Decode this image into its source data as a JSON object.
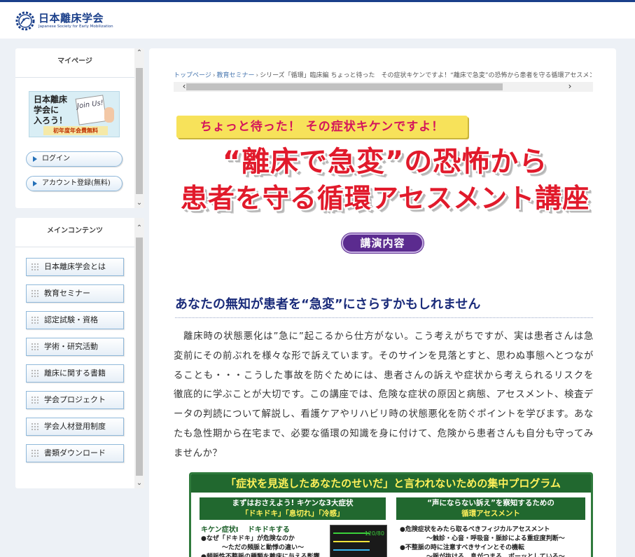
{
  "colors": {
    "brand": "#1a3f8a",
    "title_red": "#e11a2b",
    "accent_green": "#21682f",
    "accent_purple": "#5b2b8f"
  },
  "header": {
    "logo_jp": "日本離床学会",
    "logo_en": "Japanese Society for Early Mobilization",
    "logo_icon": "gear-logo-icon"
  },
  "sidebar": {
    "mypage": {
      "title": "マイページ",
      "banner": {
        "line1": "日本離床",
        "line2": "学会に",
        "line3": "入ろう！",
        "card": "Join Us!",
        "strip": "初年度年会費無料"
      },
      "login": "ログイン",
      "register": "アカウント登録(無料)"
    },
    "main_contents": {
      "title": "メインコンテンツ",
      "items": [
        {
          "label": "日本離床学会とは"
        },
        {
          "label": "教育セミナー"
        },
        {
          "label": "認定試験・資格"
        },
        {
          "label": "学術・研究活動"
        },
        {
          "label": "離床に関する書籍"
        },
        {
          "label": "学会プロジェクト"
        },
        {
          "label": "学会人材登用制度"
        },
        {
          "label": "書類ダウンロード"
        }
      ]
    }
  },
  "main": {
    "breadcrumb": {
      "home": "トップページ",
      "seminar": "教育セミナー",
      "current": "シリーズ「循環」臨床編 ちょっと待った　その症状キケンですよ！“離床で急変”の恐怖から患者を守る循環アセスメント講座"
    },
    "hero": {
      "tag": "ちょっと待った！ その症状キケンですよ！",
      "title_line1": "“離床で急変”の恐怖から",
      "title_line2": "患者を守る循環アセスメント講座",
      "badge": "講演内容"
    },
    "section_heading": "あなたの無知が患者を“急変”にさらすかもしれません",
    "body": "離床時の状態悪化は”急に”起こるから仕方がない。こう考えがちですが、実は患者さんは急変前にその前ぶれを様々な形で訴えています。そのサインを見落とすと、思わぬ事態へとつながることも・・・こうした事故を防ぐためには、患者さんの訴えや症状から考えられるリスクを徹底的に学ぶことが大切です。この講座では、危険な症状の原因と病態、アセスメント、検査データの判読について解説し、看護ケアやリハビリ時の状態悪化を防ぐポイントを学びます。あなたも急性期から在宅まで、必要な循環の知識を身に付けて、危険から患者さんも自分も守ってみませんか？",
    "promo": {
      "header": "「症状を見逃したあなたのせいだ」と言われないための集中プログラム",
      "left_box_l1": "まずはおさえよう! キケンな3大症状",
      "left_box_l2": "「ドキドキ」「息切れ」「冷感」",
      "right_box_l1": "“声にならない訴え”を察知するための",
      "right_box_l2": "循環アセスメント",
      "left_sub": "キケン症状Ⅰ　 ドキドキする",
      "left_line1": "●なぜ「ドキドキ」が危険なのか",
      "left_line2": "〜ただの頻脈と動悸の違い〜",
      "left_line3": "●頻脈性不整脈の種類を離床に与える影響",
      "right_line1": "●危険症状をみたら取るべきフィジカルアセスメント",
      "right_line2": "〜触診・心音・呼吸音・脈診による重症度判断〜",
      "right_line3": "●不整脈の時に注意すべきサインとその機転",
      "right_line4": "〜脈が抜ける、息がつまる、ボーッとしている〜",
      "monitor_val": "120/80"
    }
  }
}
